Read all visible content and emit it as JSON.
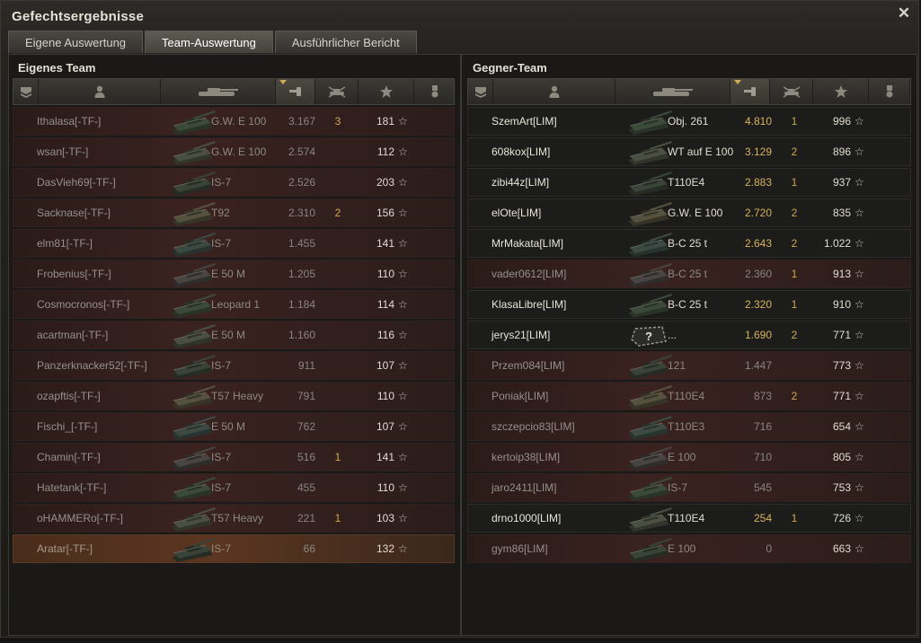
{
  "window": {
    "title": "Gefechtsergebnisse",
    "close_icon": "close-icon"
  },
  "tabs": [
    {
      "label": "Eigene Auswertung",
      "active": false
    },
    {
      "label": "Team-Auswertung",
      "active": true
    },
    {
      "label": "Ausführlicher Bericht",
      "active": false
    }
  ],
  "teams": {
    "own": {
      "title": "Eigenes Team",
      "rows": [
        {
          "name": "Ithalasa[-TF-]",
          "vehicle": "G.W. E 100",
          "damage": "3.167",
          "kills": "3",
          "xp": "181",
          "state": "dead"
        },
        {
          "name": "wsan[-TF-]",
          "vehicle": "G.W. E 100",
          "damage": "2.574",
          "kills": "",
          "xp": "112",
          "state": "dead"
        },
        {
          "name": "DasVieh69[-TF-]",
          "vehicle": "IS-7",
          "damage": "2.526",
          "kills": "",
          "xp": "203",
          "state": "dead"
        },
        {
          "name": "Sacknase[-TF-]",
          "vehicle": "T92",
          "damage": "2.310",
          "kills": "2",
          "xp": "156",
          "state": "dead"
        },
        {
          "name": "elm81[-TF-]",
          "vehicle": "IS-7",
          "damage": "1.455",
          "kills": "",
          "xp": "141",
          "state": "dead"
        },
        {
          "name": "Frobenius[-TF-]",
          "vehicle": "E 50 M",
          "damage": "1.205",
          "kills": "",
          "xp": "110",
          "state": "dead"
        },
        {
          "name": "Cosmocronos[-TF-]",
          "vehicle": "Leopard 1",
          "damage": "1.184",
          "kills": "",
          "xp": "114",
          "state": "dead"
        },
        {
          "name": "acartman[-TF-]",
          "vehicle": "E 50 M",
          "damage": "1.160",
          "kills": "",
          "xp": "116",
          "state": "dead"
        },
        {
          "name": "Panzerknacker52[-TF-]",
          "vehicle": "IS-7",
          "damage": "911",
          "kills": "",
          "xp": "107",
          "state": "dead"
        },
        {
          "name": "ozapftis[-TF-]",
          "vehicle": "T57 Heavy",
          "damage": "791",
          "kills": "",
          "xp": "110",
          "state": "dead"
        },
        {
          "name": "Fischi_[-TF-]",
          "vehicle": "E 50 M",
          "damage": "762",
          "kills": "",
          "xp": "107",
          "state": "dead"
        },
        {
          "name": "Chamin[-TF-]",
          "vehicle": "IS-7",
          "damage": "516",
          "kills": "1",
          "xp": "141",
          "state": "dead"
        },
        {
          "name": "Hatetank[-TF-]",
          "vehicle": "IS-7",
          "damage": "455",
          "kills": "",
          "xp": "110",
          "state": "dead"
        },
        {
          "name": "oHAMMERo[-TF-]",
          "vehicle": "T57 Heavy",
          "damage": "221",
          "kills": "1",
          "xp": "103",
          "state": "dead"
        },
        {
          "name": "Aratar[-TF-]",
          "vehicle": "IS-7",
          "damage": "66",
          "kills": "",
          "xp": "132",
          "state": "me"
        }
      ]
    },
    "enemy": {
      "title": "Gegner-Team",
      "rows": [
        {
          "name": "SzemArt[LIM]",
          "vehicle": "Obj. 261",
          "damage": "4.810",
          "kills": "1",
          "xp": "996",
          "state": "alive"
        },
        {
          "name": "608kox[LIM]",
          "vehicle": "WT auf E 100",
          "damage": "3.129",
          "kills": "2",
          "xp": "896",
          "state": "alive"
        },
        {
          "name": "zibi44z[LIM]",
          "vehicle": "T110E4",
          "damage": "2.883",
          "kills": "1",
          "xp": "937",
          "state": "alive"
        },
        {
          "name": "elOte[LIM]",
          "vehicle": "G.W. E 100",
          "damage": "2.720",
          "kills": "2",
          "xp": "835",
          "state": "alive"
        },
        {
          "name": "MrMakata[LIM]",
          "vehicle": "B-C 25 t",
          "damage": "2.643",
          "kills": "2",
          "xp": "1.022",
          "state": "alive"
        },
        {
          "name": "vader0612[LIM]",
          "vehicle": "B-C 25 t",
          "damage": "2.360",
          "kills": "1",
          "xp": "913",
          "state": "dead"
        },
        {
          "name": "KlasaLibre[LIM]",
          "vehicle": "B-C 25 t",
          "damage": "2.320",
          "kills": "1",
          "xp": "910",
          "state": "alive"
        },
        {
          "name": "jerys21[LIM]",
          "vehicle": "...",
          "damage": "1.690",
          "kills": "2",
          "xp": "771",
          "state": "alive",
          "unknown": true
        },
        {
          "name": "Przem084[LIM]",
          "vehicle": "121",
          "damage": "1.447",
          "kills": "",
          "xp": "773",
          "state": "dead"
        },
        {
          "name": "Poniak[LIM]",
          "vehicle": "T110E4",
          "damage": "873",
          "kills": "2",
          "xp": "771",
          "state": "dead"
        },
        {
          "name": "szczepcio83[LIM]",
          "vehicle": "T110E3",
          "damage": "716",
          "kills": "",
          "xp": "654",
          "state": "dead"
        },
        {
          "name": "kertoip38[LIM]",
          "vehicle": "E 100",
          "damage": "710",
          "kills": "",
          "xp": "805",
          "state": "dead"
        },
        {
          "name": "jaro2411[LIM]",
          "vehicle": "IS-7",
          "damage": "545",
          "kills": "",
          "xp": "753",
          "state": "dead"
        },
        {
          "name": "drno1000[LIM]",
          "vehicle": "T110E4",
          "damage": "254",
          "kills": "1",
          "xp": "726",
          "state": "alive"
        },
        {
          "name": "gym86[LIM]",
          "vehicle": "E 100",
          "damage": "0",
          "kills": "",
          "xp": "663",
          "state": "dead"
        }
      ]
    }
  },
  "unknown_tank_glyph": "?",
  "star_glyph": "☆"
}
